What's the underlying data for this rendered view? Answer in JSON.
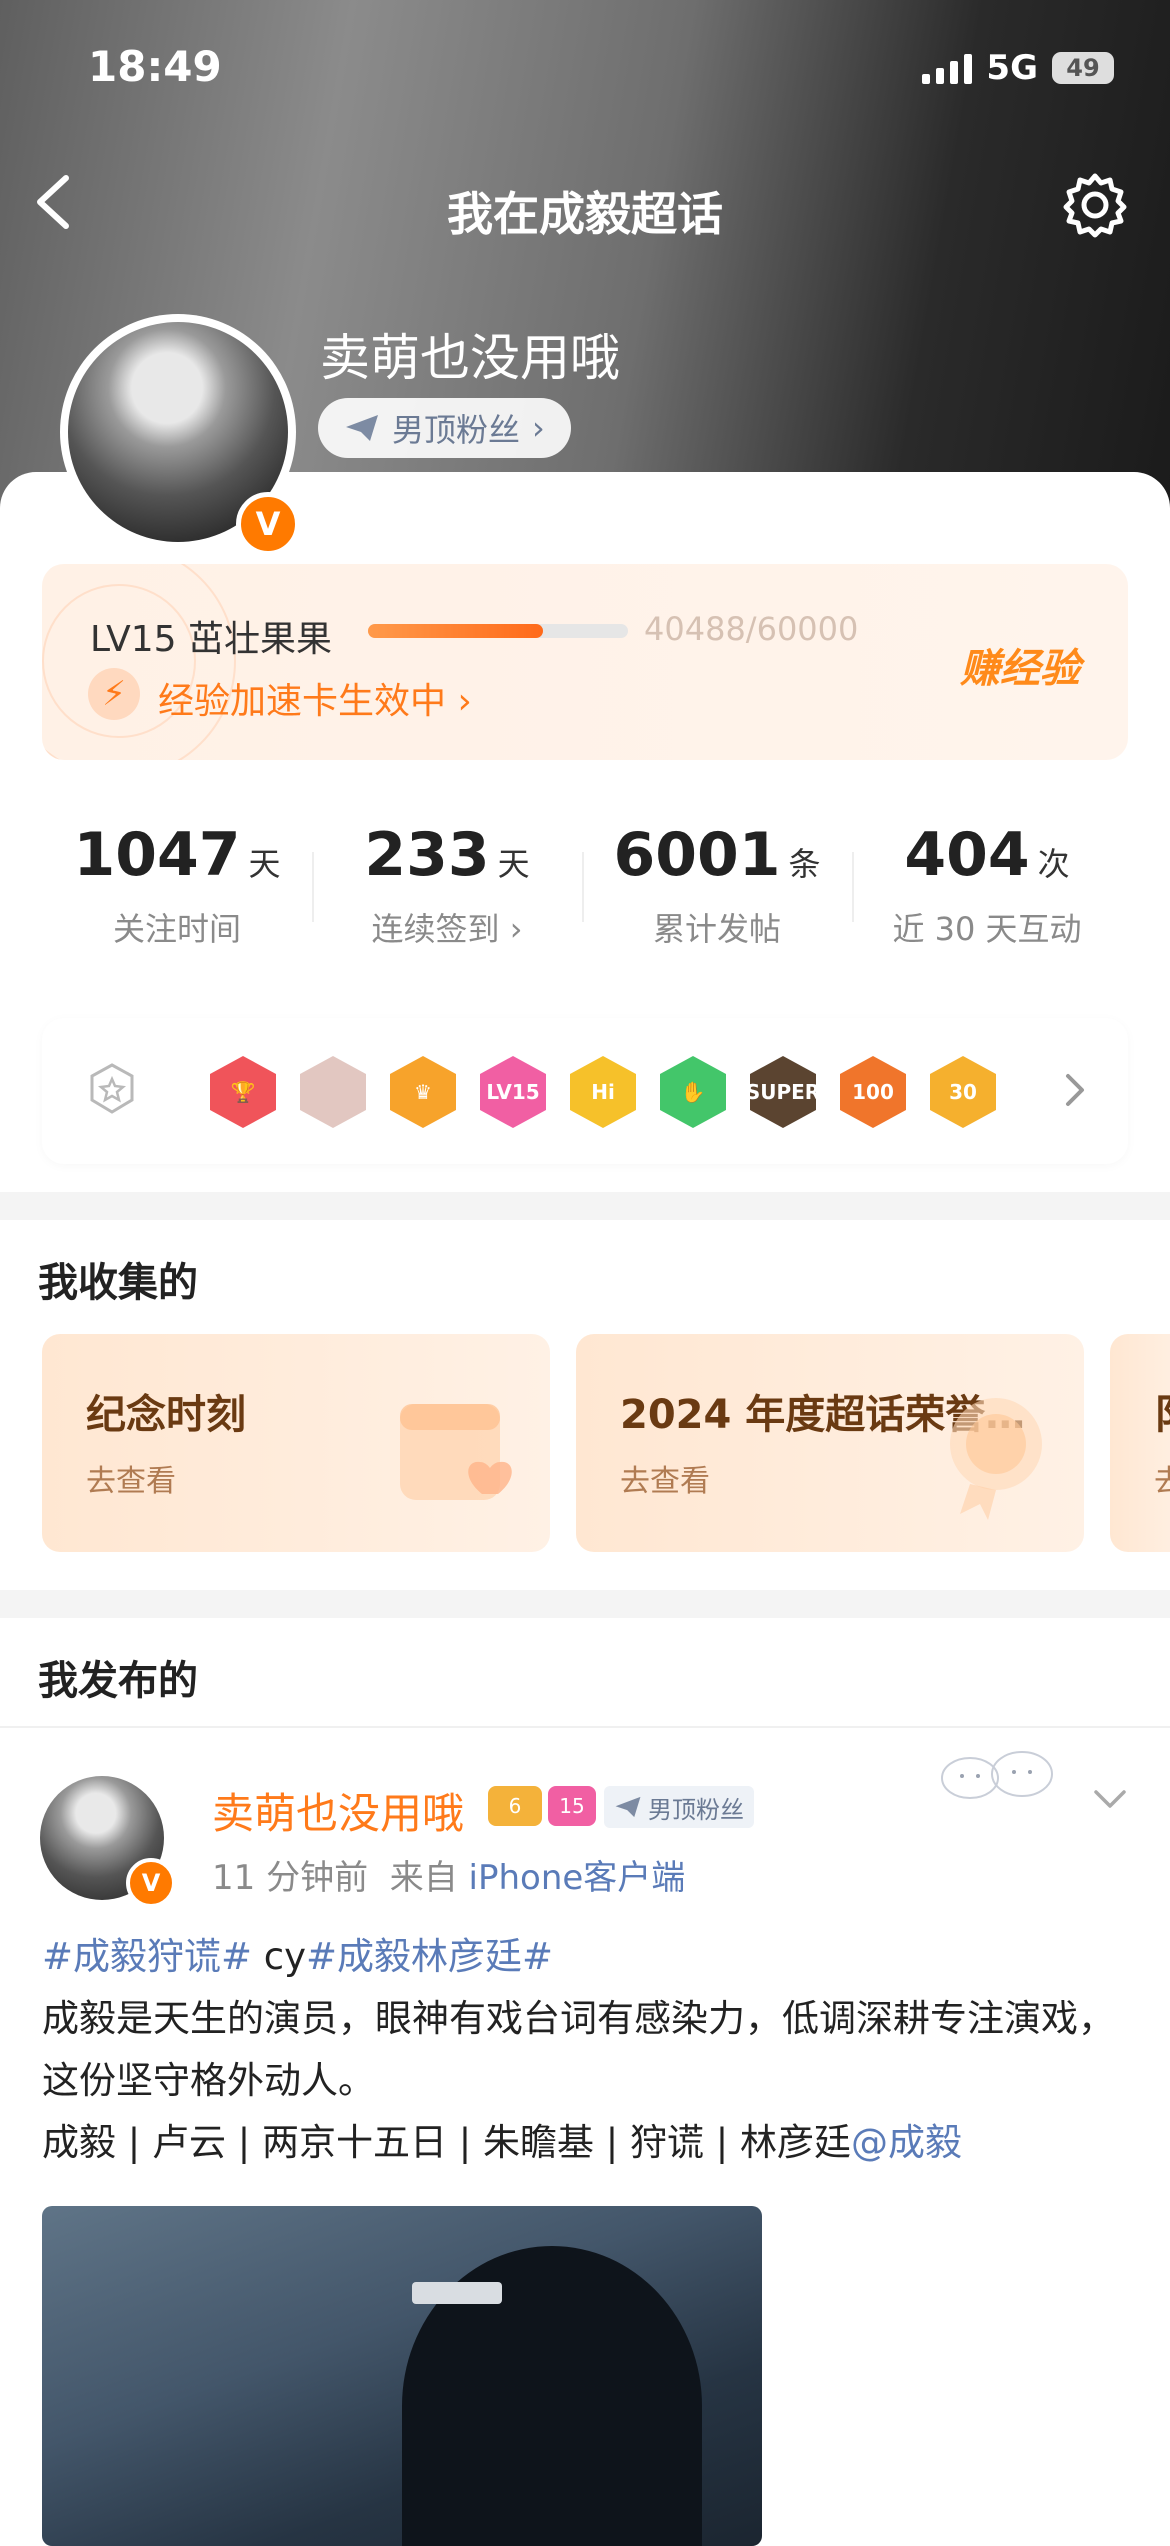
{
  "status_bar": {
    "time": "18:49",
    "network": "5G",
    "battery": "49"
  },
  "header": {
    "title": "我在成毅超话"
  },
  "profile": {
    "username": "卖萌也没用哦",
    "fan_tag": "男顶粉丝",
    "badge": "V"
  },
  "level": {
    "label": "LV15 茁壮果果",
    "current": 40488,
    "max": 60000,
    "progress_text": "40488/60000",
    "boost_text": "经验加速卡生效中",
    "earn_label": "赚经验"
  },
  "stats": [
    {
      "value": "1047",
      "unit": "天",
      "label": "关注时间"
    },
    {
      "value": "233",
      "unit": "天",
      "label": "连续签到"
    },
    {
      "value": "6001",
      "unit": "条",
      "label": "累计发帖"
    },
    {
      "value": "404",
      "unit": "次",
      "label": "近 30 天互动"
    }
  ],
  "medals": [
    {
      "name": "trophy-medal",
      "color": "#f0545a",
      "text": "🏆"
    },
    {
      "name": "chibi-medal",
      "color": "#e2c7c1",
      "text": ""
    },
    {
      "name": "crown-medal",
      "color": "#f7a32b",
      "text": "♛"
    },
    {
      "name": "lv15-medal",
      "color": "#f15fa3",
      "text": "LV15"
    },
    {
      "name": "hi-medal",
      "color": "#f6c12a",
      "text": "Hi"
    },
    {
      "name": "hand-medal",
      "color": "#43c66a",
      "text": "✋"
    },
    {
      "name": "super-medal",
      "color": "#5b4430",
      "text": "SUPER"
    },
    {
      "name": "100-days-medal",
      "color": "#f0752b",
      "text": "100"
    },
    {
      "name": "30-days-medal",
      "color": "#f5b02e",
      "text": "30"
    }
  ],
  "collected": {
    "title": "我收集的",
    "items": [
      {
        "title": "纪念时刻",
        "sub": "去查看"
      },
      {
        "title": "2024 年度超话荣誉…",
        "sub": "去查看"
      },
      {
        "title": "阝",
        "sub": "去"
      }
    ]
  },
  "published": {
    "title": "我发布的",
    "post": {
      "author": "卖萌也没用哦",
      "fan_tag": "男顶粉丝",
      "level_badge": "15",
      "rank_badge": "6",
      "time": "11 分钟前",
      "source_prefix": "来自",
      "source": "iPhone客户端",
      "hashtag1": "#成毅狩谎#",
      "mid": " cy",
      "hashtag2": "#成毅林彦廷#",
      "body": "成毅是天生的演员，眼神有戏台词有感染力，低调深耕专注演戏，这份坚守格外动人。",
      "tags_line": "成毅 | 卢云 | 两京十五日 | 朱瞻基  | 狩谎 | 林彦廷",
      "mention": "@成毅"
    }
  }
}
